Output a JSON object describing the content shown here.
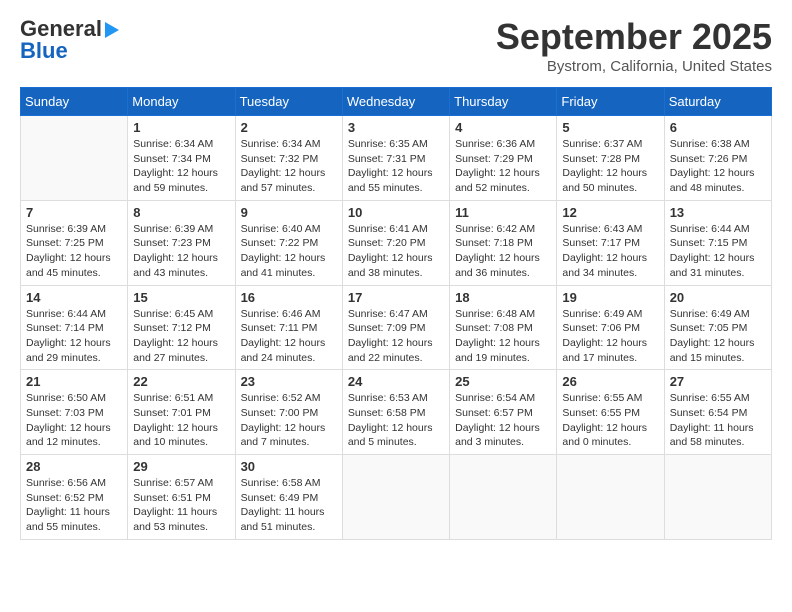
{
  "header": {
    "logo_line1": "General",
    "logo_line2": "Blue",
    "month": "September 2025",
    "location": "Bystrom, California, United States"
  },
  "weekdays": [
    "Sunday",
    "Monday",
    "Tuesday",
    "Wednesday",
    "Thursday",
    "Friday",
    "Saturday"
  ],
  "weeks": [
    [
      {
        "day": "",
        "info": ""
      },
      {
        "day": "1",
        "info": "Sunrise: 6:34 AM\nSunset: 7:34 PM\nDaylight: 12 hours\nand 59 minutes."
      },
      {
        "day": "2",
        "info": "Sunrise: 6:34 AM\nSunset: 7:32 PM\nDaylight: 12 hours\nand 57 minutes."
      },
      {
        "day": "3",
        "info": "Sunrise: 6:35 AM\nSunset: 7:31 PM\nDaylight: 12 hours\nand 55 minutes."
      },
      {
        "day": "4",
        "info": "Sunrise: 6:36 AM\nSunset: 7:29 PM\nDaylight: 12 hours\nand 52 minutes."
      },
      {
        "day": "5",
        "info": "Sunrise: 6:37 AM\nSunset: 7:28 PM\nDaylight: 12 hours\nand 50 minutes."
      },
      {
        "day": "6",
        "info": "Sunrise: 6:38 AM\nSunset: 7:26 PM\nDaylight: 12 hours\nand 48 minutes."
      }
    ],
    [
      {
        "day": "7",
        "info": "Sunrise: 6:39 AM\nSunset: 7:25 PM\nDaylight: 12 hours\nand 45 minutes."
      },
      {
        "day": "8",
        "info": "Sunrise: 6:39 AM\nSunset: 7:23 PM\nDaylight: 12 hours\nand 43 minutes."
      },
      {
        "day": "9",
        "info": "Sunrise: 6:40 AM\nSunset: 7:22 PM\nDaylight: 12 hours\nand 41 minutes."
      },
      {
        "day": "10",
        "info": "Sunrise: 6:41 AM\nSunset: 7:20 PM\nDaylight: 12 hours\nand 38 minutes."
      },
      {
        "day": "11",
        "info": "Sunrise: 6:42 AM\nSunset: 7:18 PM\nDaylight: 12 hours\nand 36 minutes."
      },
      {
        "day": "12",
        "info": "Sunrise: 6:43 AM\nSunset: 7:17 PM\nDaylight: 12 hours\nand 34 minutes."
      },
      {
        "day": "13",
        "info": "Sunrise: 6:44 AM\nSunset: 7:15 PM\nDaylight: 12 hours\nand 31 minutes."
      }
    ],
    [
      {
        "day": "14",
        "info": "Sunrise: 6:44 AM\nSunset: 7:14 PM\nDaylight: 12 hours\nand 29 minutes."
      },
      {
        "day": "15",
        "info": "Sunrise: 6:45 AM\nSunset: 7:12 PM\nDaylight: 12 hours\nand 27 minutes."
      },
      {
        "day": "16",
        "info": "Sunrise: 6:46 AM\nSunset: 7:11 PM\nDaylight: 12 hours\nand 24 minutes."
      },
      {
        "day": "17",
        "info": "Sunrise: 6:47 AM\nSunset: 7:09 PM\nDaylight: 12 hours\nand 22 minutes."
      },
      {
        "day": "18",
        "info": "Sunrise: 6:48 AM\nSunset: 7:08 PM\nDaylight: 12 hours\nand 19 minutes."
      },
      {
        "day": "19",
        "info": "Sunrise: 6:49 AM\nSunset: 7:06 PM\nDaylight: 12 hours\nand 17 minutes."
      },
      {
        "day": "20",
        "info": "Sunrise: 6:49 AM\nSunset: 7:05 PM\nDaylight: 12 hours\nand 15 minutes."
      }
    ],
    [
      {
        "day": "21",
        "info": "Sunrise: 6:50 AM\nSunset: 7:03 PM\nDaylight: 12 hours\nand 12 minutes."
      },
      {
        "day": "22",
        "info": "Sunrise: 6:51 AM\nSunset: 7:01 PM\nDaylight: 12 hours\nand 10 minutes."
      },
      {
        "day": "23",
        "info": "Sunrise: 6:52 AM\nSunset: 7:00 PM\nDaylight: 12 hours\nand 7 minutes."
      },
      {
        "day": "24",
        "info": "Sunrise: 6:53 AM\nSunset: 6:58 PM\nDaylight: 12 hours\nand 5 minutes."
      },
      {
        "day": "25",
        "info": "Sunrise: 6:54 AM\nSunset: 6:57 PM\nDaylight: 12 hours\nand 3 minutes."
      },
      {
        "day": "26",
        "info": "Sunrise: 6:55 AM\nSunset: 6:55 PM\nDaylight: 12 hours\nand 0 minutes."
      },
      {
        "day": "27",
        "info": "Sunrise: 6:55 AM\nSunset: 6:54 PM\nDaylight: 11 hours\nand 58 minutes."
      }
    ],
    [
      {
        "day": "28",
        "info": "Sunrise: 6:56 AM\nSunset: 6:52 PM\nDaylight: 11 hours\nand 55 minutes."
      },
      {
        "day": "29",
        "info": "Sunrise: 6:57 AM\nSunset: 6:51 PM\nDaylight: 11 hours\nand 53 minutes."
      },
      {
        "day": "30",
        "info": "Sunrise: 6:58 AM\nSunset: 6:49 PM\nDaylight: 11 hours\nand 51 minutes."
      },
      {
        "day": "",
        "info": ""
      },
      {
        "day": "",
        "info": ""
      },
      {
        "day": "",
        "info": ""
      },
      {
        "day": "",
        "info": ""
      }
    ]
  ]
}
